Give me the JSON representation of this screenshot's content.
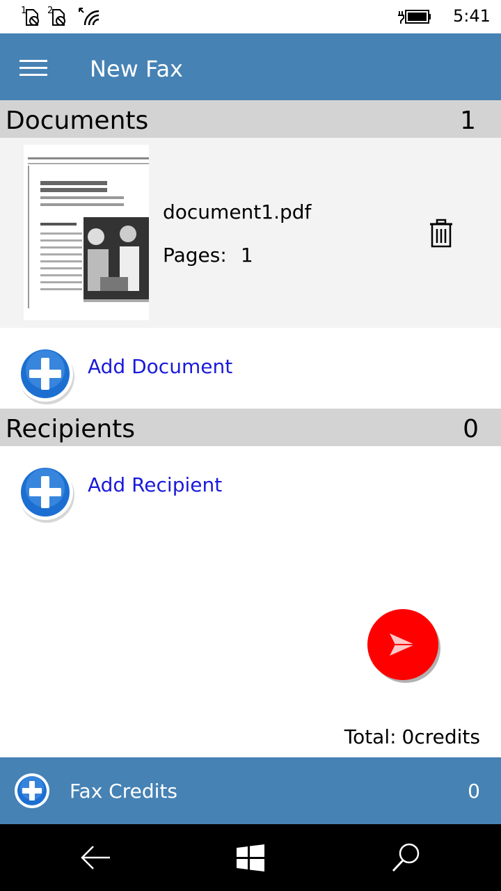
{
  "status_bar": {
    "sim1_label": "1",
    "sim2_label": "2",
    "time": "5:41"
  },
  "header": {
    "title": "New Fax"
  },
  "documents": {
    "section_label": "Documents",
    "count": "1",
    "items": [
      {
        "name": "document1.pdf",
        "pages_label": "Pages:",
        "pages_value": "1"
      }
    ],
    "add_label": "Add Document"
  },
  "recipients": {
    "section_label": "Recipients",
    "count": "0",
    "add_label": "Add Recipient"
  },
  "total": {
    "label": "Total:",
    "value": "0credits"
  },
  "fax_credits": {
    "label": "Fax Credits",
    "count": "0"
  },
  "colors": {
    "brand_blue": "#4682b4",
    "section_gray": "#d3d3d3",
    "link_blue": "#1a1adb",
    "send_red": "#ff0000"
  },
  "icons": {
    "menu": "hamburger-icon",
    "delete": "trash-icon",
    "add": "plus-circle-icon",
    "send": "send-icon",
    "back": "back-arrow-icon",
    "home": "windows-logo-icon",
    "search": "search-icon"
  }
}
